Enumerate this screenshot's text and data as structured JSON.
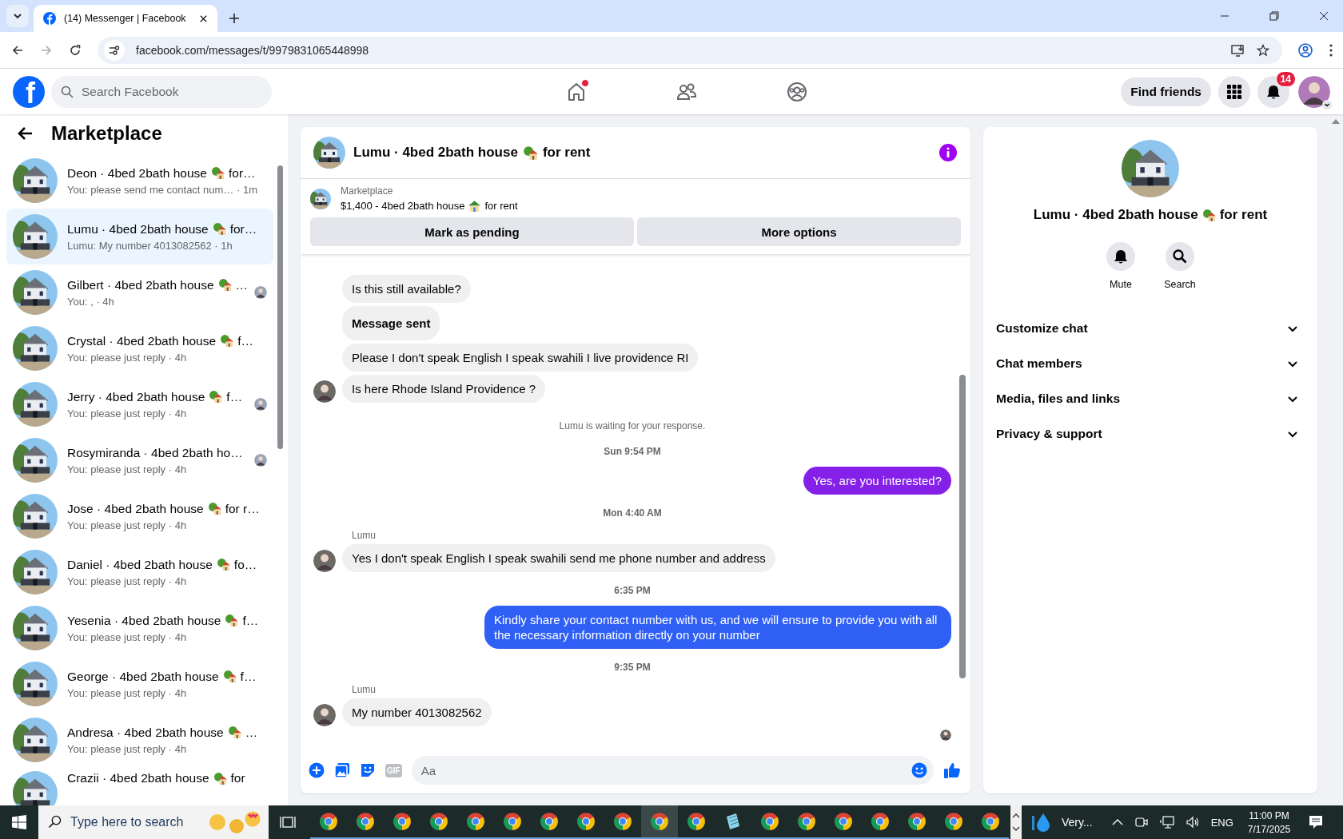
{
  "browser": {
    "tab_title": "(14) Messenger | Facebook",
    "url": "facebook.com/messages/t/9979831065448998"
  },
  "header": {
    "logo": "f",
    "search_placeholder": "Search Facebook",
    "nav": [
      {
        "kind": "home",
        "selected": false,
        "dot": true
      },
      {
        "kind": "friends",
        "selected": false,
        "dot": false
      },
      {
        "kind": "groups",
        "selected": false,
        "dot": false
      }
    ],
    "find_friends": "Find friends",
    "notifications_count": "14"
  },
  "left": {
    "title": "Marketplace",
    "conversations": [
      {
        "name": "Deon · 4bed 2bath house",
        "emoji": true,
        "name_end": "for…",
        "meta": "You: please send me contact num… · 1m",
        "selected": false,
        "read_receipt": false
      },
      {
        "name": "Lumu · 4bed 2bath house",
        "emoji": true,
        "name_end": "for…",
        "meta": "Lumu: My number 4013082562 · 1h",
        "selected": true,
        "read_receipt": false
      },
      {
        "name": "Gilbert · 4bed 2bath house",
        "emoji": true,
        "name_end": "…",
        "meta": "You: , · 4h",
        "selected": false,
        "read_receipt": true
      },
      {
        "name": "Crystal · 4bed 2bath house",
        "emoji": true,
        "name_end": "f…",
        "meta": "You: please just reply · 4h",
        "selected": false,
        "read_receipt": false
      },
      {
        "name": "Jerry · 4bed 2bath house",
        "emoji": true,
        "name_end": "f…",
        "meta": "You: please just reply · 4h",
        "selected": false,
        "read_receipt": true
      },
      {
        "name": "Rosymiranda · 4bed 2bath ho…",
        "emoji": false,
        "meta": "You: please just reply · 4h",
        "selected": false,
        "read_receipt": true
      },
      {
        "name": "Jose · 4bed 2bath house",
        "emoji": true,
        "name_end": "for r…",
        "meta": "You: please just reply · 4h",
        "selected": false,
        "read_receipt": false
      },
      {
        "name": "Daniel · 4bed 2bath house",
        "emoji": true,
        "name_end": "fo…",
        "meta": "You: please just reply · 4h",
        "selected": false,
        "read_receipt": false
      },
      {
        "name": "Yesenia · 4bed 2bath house",
        "emoji": true,
        "name_end": "f…",
        "meta": "You: please just reply · 4h",
        "selected": false,
        "read_receipt": false
      },
      {
        "name": "George · 4bed 2bath house",
        "emoji": true,
        "name_end": "f…",
        "meta": "You: please just reply · 4h",
        "selected": false,
        "read_receipt": false
      },
      {
        "name": "Andresa · 4bed 2bath house",
        "emoji": true,
        "name_end": "…",
        "meta": "You: please just reply · 4h",
        "selected": false,
        "read_receipt": false
      },
      {
        "name": "Crazii · 4bed 2bath house",
        "emoji": true,
        "name_end": "for",
        "selected": false,
        "read_receipt": false
      }
    ]
  },
  "chat": {
    "title": "Lumu · 4bed 2bath house",
    "title_end": "for rent",
    "listing": {
      "label": "Marketplace",
      "title": "$1,400 - 4bed 2bath house",
      "title_end": "for rent"
    },
    "actions": [
      "Mark as pending",
      "More options"
    ],
    "messages": [
      {
        "kind": "incoming",
        "text": "Is this still available?",
        "avatar": false,
        "bold": false
      },
      {
        "kind": "incoming",
        "text": "Message sent",
        "avatar": false,
        "bold": true
      },
      {
        "kind": "incoming",
        "text": "Please I don't speak English I speak swahili I live providence RI",
        "avatar": false,
        "bold": false
      },
      {
        "kind": "incoming",
        "text": "Is here Rhode Island Providence ?",
        "avatar": true,
        "bold": false
      },
      {
        "kind": "system",
        "text": "Lumu is waiting for your response."
      },
      {
        "kind": "time",
        "text": "Sun 9:54 PM"
      },
      {
        "kind": "outgoing",
        "text": "Yes, are you interested?",
        "color": "#8420e8"
      },
      {
        "kind": "time",
        "text": "Mon 4:40 AM"
      },
      {
        "kind": "sender",
        "text": "Lumu"
      },
      {
        "kind": "incoming",
        "text": "Yes I don't speak English I speak swahili send me phone number and address",
        "avatar": true,
        "bold": false
      },
      {
        "kind": "time",
        "text": "6:35 PM"
      },
      {
        "kind": "outgoing",
        "text": "Kindly share your contact number with us, and we will ensure to provide you with all the necessary information directly on your number",
        "color": "#2f5ff5"
      },
      {
        "kind": "time",
        "text": "9:35 PM"
      },
      {
        "kind": "sender",
        "text": "Lumu"
      },
      {
        "kind": "incoming",
        "text": "My number 4013082562",
        "avatar": true,
        "bold": false
      }
    ],
    "seen": true,
    "composer": {
      "gif_label": "GIF",
      "placeholder": "Aa"
    }
  },
  "right": {
    "title": "Lumu · 4bed 2bath house",
    "title_end": "for rent",
    "actions": [
      {
        "kind": "mute",
        "label": "Mute"
      },
      {
        "kind": "search",
        "label": "Search"
      }
    ],
    "sections": [
      {
        "label": "Customize chat",
        "expanded": false
      },
      {
        "label": "Chat members",
        "expanded": false
      },
      {
        "label": "Media, files and links",
        "expanded": false
      },
      {
        "label": "Privacy & support",
        "expanded": false
      }
    ]
  },
  "taskbar": {
    "search_placeholder": "Type here to search",
    "apps": [
      {
        "kind": "chrome",
        "active": false
      },
      {
        "kind": "chrome",
        "active": false
      },
      {
        "kind": "chrome",
        "active": false
      },
      {
        "kind": "chrome",
        "active": false
      },
      {
        "kind": "chrome",
        "active": false
      },
      {
        "kind": "chrome",
        "active": false
      },
      {
        "kind": "chrome",
        "active": false
      },
      {
        "kind": "chrome",
        "active": false
      },
      {
        "kind": "chrome",
        "active": false
      },
      {
        "kind": "chrome",
        "active": true
      },
      {
        "kind": "chrome",
        "active": false
      },
      {
        "kind": "notes",
        "active": false
      },
      {
        "kind": "chrome",
        "active": false
      },
      {
        "kind": "chrome",
        "active": false
      },
      {
        "kind": "chrome",
        "active": false
      },
      {
        "kind": "chrome",
        "active": false
      },
      {
        "kind": "chrome",
        "active": false
      },
      {
        "kind": "chrome",
        "active": false
      },
      {
        "kind": "chrome",
        "active": false
      }
    ],
    "weather": "Very...",
    "language": "ENG",
    "time": "11:00 PM",
    "date": "7/17/2025"
  }
}
